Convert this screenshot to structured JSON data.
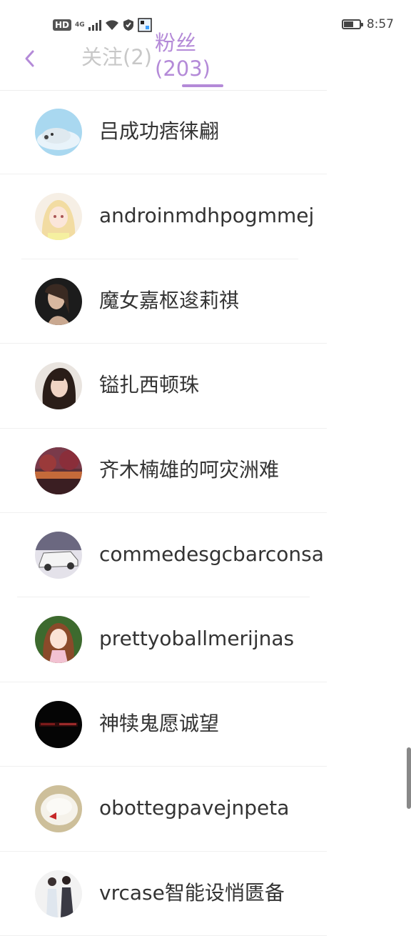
{
  "status_bar": {
    "hd": "HD",
    "network": "4G",
    "time": "8:57",
    "battery_level": 0.7
  },
  "header": {
    "back_icon": "chevron-left-icon",
    "tab_follow": "关注(2)",
    "tab_fans_line1": "粉丝",
    "tab_fans_line2": "(203)",
    "accent_color": "#b48ad8"
  },
  "fans": [
    {
      "name": "吕成功痞徕翩",
      "avatar": "seal-avatar"
    },
    {
      "name": "androinmdhpogmmej",
      "avatar": "anime-girl-avatar"
    },
    {
      "name": "魔女嘉枢逡莉祺",
      "avatar": "woman-portrait-avatar"
    },
    {
      "name": "镒扎西顿珠",
      "avatar": "woman-selfie-avatar"
    },
    {
      "name": "齐木楠雄的呵灾洲难",
      "avatar": "landscape-avatar"
    },
    {
      "name": "commedesgcbarconsa",
      "avatar": "car-avatar"
    },
    {
      "name": "prettyoballmerijnas",
      "avatar": "anime-princess-avatar"
    },
    {
      "name": "神犊鬼愿诚望",
      "avatar": "dark-text-avatar"
    },
    {
      "name": "obottegpavejnpeta",
      "avatar": "cake-avatar"
    },
    {
      "name": "vrcase智能设悄匮备",
      "avatar": "couple-avatar"
    }
  ]
}
